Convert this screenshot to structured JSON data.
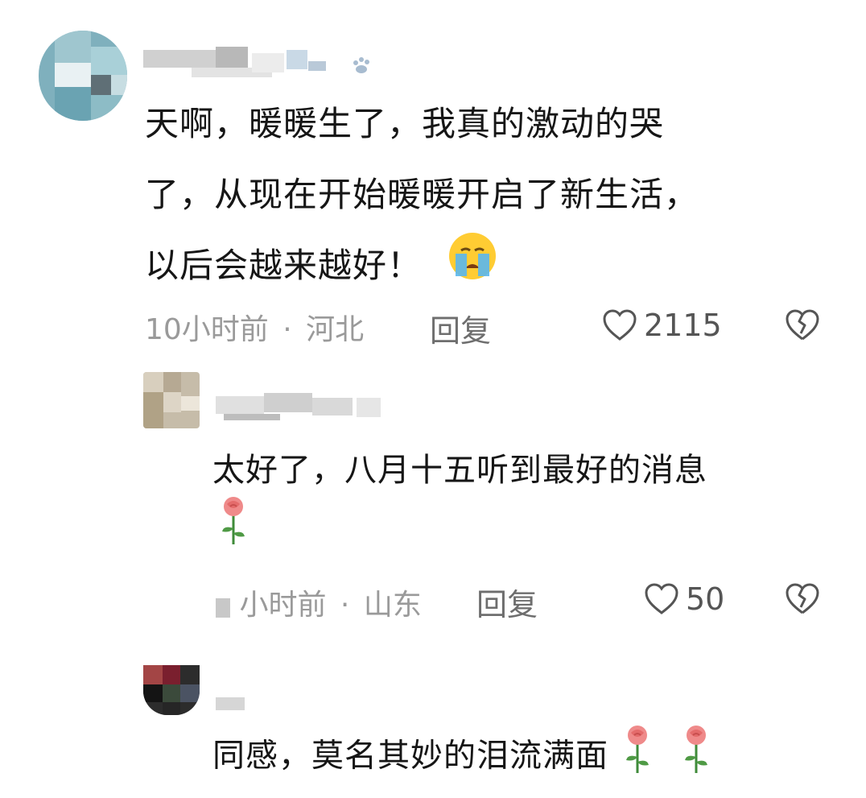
{
  "comments": [
    {
      "text_lines": [
        "天啊，暖暖生了，我真的激动的哭",
        "了，从现在开始暖暖开启了新生活，",
        "以后会越来越好！"
      ],
      "time": "10小时前",
      "dot": "·",
      "location": "河北",
      "reply_label": "回复",
      "likes": "2115",
      "emojis": [
        "crying-face"
      ]
    },
    {
      "text_line1": "太好了，八月十五听到最好的消息",
      "time": "小时前",
      "dot": "·",
      "location": "山东",
      "reply_label": "回复",
      "likes": "50",
      "emojis": [
        "rose"
      ]
    },
    {
      "text_line1": "同感，莫名其妙的泪流满面",
      "emojis": [
        "rose",
        "rose"
      ]
    }
  ],
  "colors": {
    "meta": "#9a9a9a",
    "reply": "#6e6e6e",
    "text": "#161616"
  }
}
